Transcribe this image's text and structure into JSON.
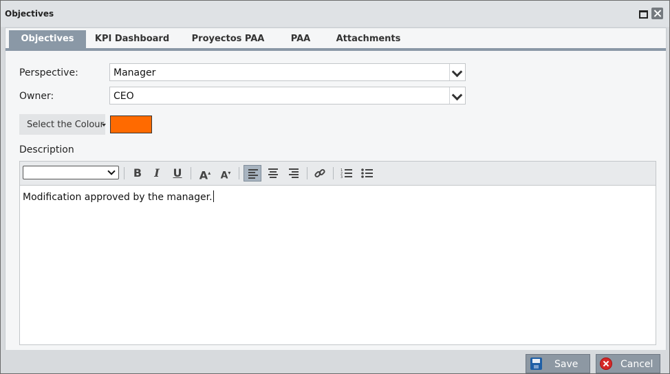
{
  "window": {
    "title": "Objectives"
  },
  "tabs": [
    {
      "label": "Objectives",
      "active": true
    },
    {
      "label": "KPI Dashboard",
      "active": false
    },
    {
      "label": "Proyectos PAA",
      "active": false
    },
    {
      "label": "PAA",
      "active": false
    },
    {
      "label": "Attachments",
      "active": false
    }
  ],
  "form": {
    "perspective": {
      "label": "Perspective:",
      "value": "Manager"
    },
    "owner": {
      "label": "Owner:",
      "value": "CEO"
    },
    "colour": {
      "button_label": "Select the Colour",
      "value": "#ff6a00"
    },
    "description": {
      "label": "Description",
      "font_value": "",
      "text": "Modification approved by the manager."
    }
  },
  "toolbar": {
    "bold": "B",
    "italic": "I",
    "underline": "U",
    "grow_font": "A",
    "shrink_font": "A"
  },
  "footer": {
    "save_label": "Save",
    "cancel_label": "Cancel"
  }
}
